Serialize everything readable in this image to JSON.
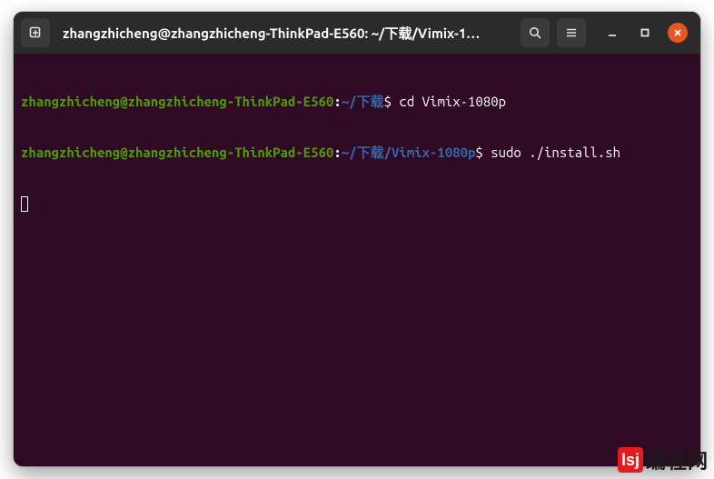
{
  "titlebar": {
    "title": "zhangzhicheng@zhangzhicheng-ThinkPad-E560: ~/下载/Vimix-1…"
  },
  "terminal": {
    "lines": [
      {
        "user": "zhangzhicheng@zhangzhicheng-ThinkPad-E560",
        "path": "~/下载",
        "command": "cd Vimix-1080p"
      },
      {
        "user": "zhangzhicheng@zhangzhicheng-ThinkPad-E560",
        "path": "~/下载/Vimix-1080p",
        "command": "sudo ./install.sh"
      }
    ]
  },
  "watermark": {
    "badge": "lsj",
    "text": "编程网"
  }
}
